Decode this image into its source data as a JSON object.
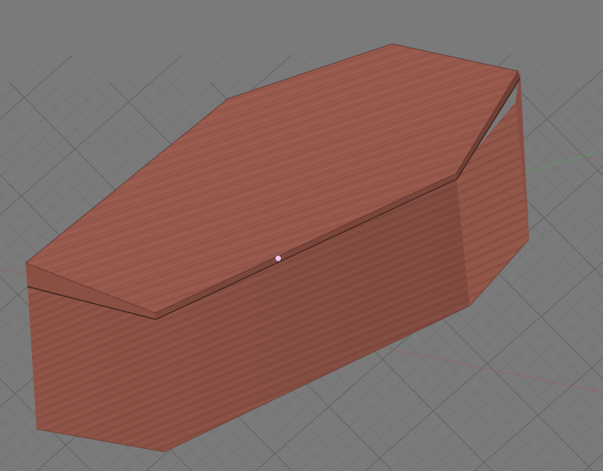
{
  "viewport": {
    "background_color": "#7a7a7a",
    "grid_minor_color": "#6f6f6f",
    "grid_major_color": "#626262",
    "x_axis_color": "#a45a5a",
    "y_axis_color": "#5f9a5f",
    "object_origin_color": "#f2c7ea"
  },
  "object": {
    "type": "coffin",
    "material": "wood-texture",
    "base_color": "#9a5a4d",
    "lid_color": "#8f5447",
    "side_color": "#834b40",
    "edge_color": "#5d332c",
    "seam_color": "#3e2420"
  }
}
